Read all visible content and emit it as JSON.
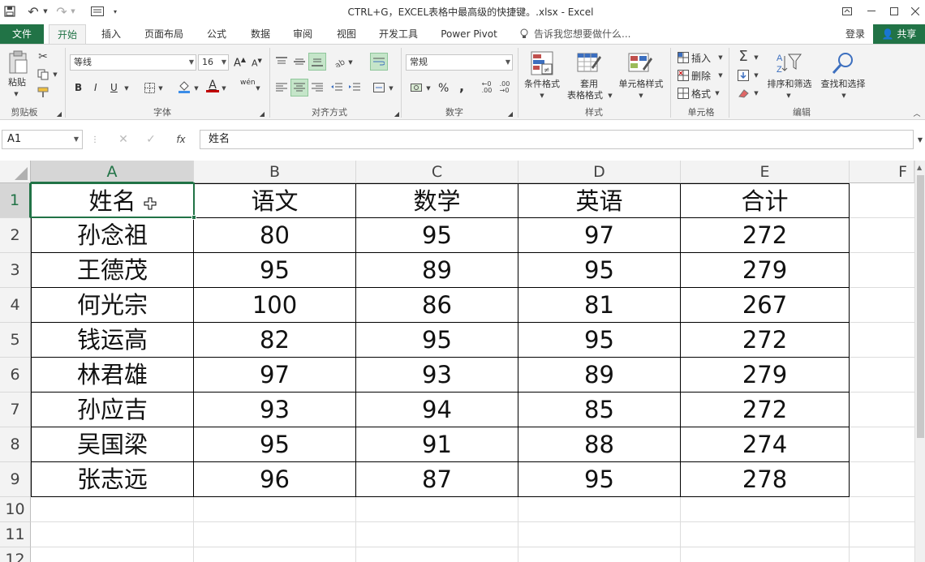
{
  "titlebar": {
    "title": "CTRL+G，EXCEL表格中最高级的快捷键。.xlsx - Excel",
    "undo_label": "↶",
    "redo_label": "↷"
  },
  "tabs": {
    "file": "文件",
    "items": [
      {
        "label": "开始",
        "active": true
      },
      {
        "label": "插入"
      },
      {
        "label": "页面布局"
      },
      {
        "label": "公式"
      },
      {
        "label": "数据"
      },
      {
        "label": "审阅"
      },
      {
        "label": "视图"
      },
      {
        "label": "开发工具"
      },
      {
        "label": "Power Pivot"
      }
    ],
    "tell_me": "告诉我您想要做什么...",
    "login": "登录",
    "share": "共享"
  },
  "ribbon": {
    "clipboard": {
      "paste": "粘贴",
      "label": "剪贴板"
    },
    "font": {
      "name": "等线",
      "size": "16",
      "bold": "B",
      "italic": "I",
      "underline": "U",
      "label": "字体",
      "grow": "A",
      "shrink": "A",
      "color_letter": "A",
      "phonetic": "wén"
    },
    "alignment": {
      "label": "对齐方式"
    },
    "number": {
      "format": "常规",
      "percent": "%",
      "comma": ",",
      "label": "数字"
    },
    "styles": {
      "conditional": "条件格式",
      "table_format_1": "套用",
      "table_format_2": "表格格式",
      "cell_styles": "单元格样式",
      "label": "样式"
    },
    "cells": {
      "insert": "插入",
      "delete": "删除",
      "format": "格式",
      "label": "单元格"
    },
    "editing": {
      "sort": "排序和筛选",
      "find": "查找和选择",
      "label": "编辑"
    }
  },
  "formula": {
    "name_box": "A1",
    "content": "姓名",
    "fx": "fx"
  },
  "sheet": {
    "columns": [
      "A",
      "B",
      "C",
      "D",
      "E",
      "F"
    ],
    "rows": [
      "1",
      "2",
      "3",
      "4",
      "5",
      "6",
      "7",
      "8",
      "9",
      "10",
      "11",
      "12"
    ],
    "header": [
      "姓名",
      "语文",
      "数学",
      "英语",
      "合计"
    ],
    "data": [
      [
        "孙念祖",
        "80",
        "95",
        "97",
        "272"
      ],
      [
        "王德茂",
        "95",
        "89",
        "95",
        "279"
      ],
      [
        "何光宗",
        "100",
        "86",
        "81",
        "267"
      ],
      [
        "钱运高",
        "82",
        "95",
        "95",
        "272"
      ],
      [
        "林君雄",
        "97",
        "93",
        "89",
        "279"
      ],
      [
        "孙应吉",
        "93",
        "94",
        "85",
        "272"
      ],
      [
        "吴国梁",
        "95",
        "91",
        "88",
        "274"
      ],
      [
        "张志远",
        "96",
        "87",
        "95",
        "278"
      ]
    ]
  },
  "colors": {
    "accent": "#217346",
    "ribbon_bg": "#f3f3f3"
  }
}
